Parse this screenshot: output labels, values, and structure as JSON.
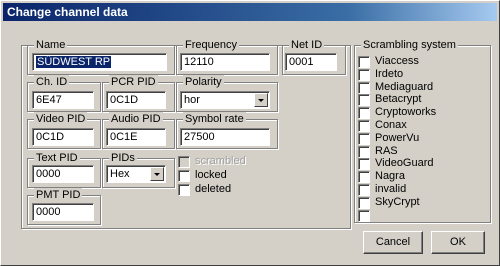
{
  "title": "Change channel data",
  "name": {
    "label": "Name",
    "value": "SÜDWEST RP"
  },
  "frequency": {
    "label": "Frequency",
    "value": "12110"
  },
  "net_id": {
    "label": "Net ID",
    "value": "0001"
  },
  "ch_id": {
    "label": "Ch. ID",
    "value": "6E47"
  },
  "pcr_pid": {
    "label": "PCR PID",
    "value": "0C1D"
  },
  "polarity": {
    "label": "Polarity",
    "value": "hor"
  },
  "video_pid": {
    "label": "Video PID",
    "value": "0C1D"
  },
  "audio_pid": {
    "label": "Audio PID",
    "value": "0C1E"
  },
  "symbol_rate": {
    "label": "Symbol rate",
    "value": "27500"
  },
  "text_pid": {
    "label": "Text PID",
    "value": "0000"
  },
  "pids": {
    "label": "PIDs",
    "value": "Hex"
  },
  "pmt_pid": {
    "label": "PMT PID",
    "value": "0000"
  },
  "flags": [
    {
      "label": "scrambled",
      "checked": false,
      "disabled": true
    },
    {
      "label": "locked",
      "checked": false,
      "disabled": false
    },
    {
      "label": "deleted",
      "checked": false,
      "disabled": false
    }
  ],
  "scrambling": {
    "label": "Scrambling system",
    "items": [
      "Viaccess",
      "Irdeto",
      "Mediaguard",
      "Betacrypt",
      "Cryptoworks",
      "Conax",
      "PowerVu",
      "RAS",
      "VideoGuard",
      "Nagra",
      "invalid",
      "SkyCrypt",
      ""
    ]
  },
  "buttons": {
    "cancel": "Cancel",
    "ok": "OK"
  }
}
